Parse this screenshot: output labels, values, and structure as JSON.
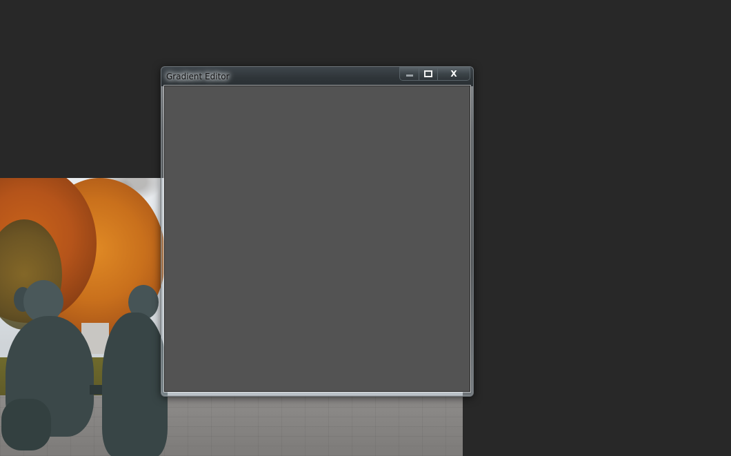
{
  "desktop": {
    "background_color": "#282828"
  },
  "window": {
    "title": "Gradient Editor",
    "client_color": "#535353",
    "buttons": {
      "minimize_icon": "minimize-icon",
      "maximize_icon": "maximize-icon",
      "close_icon": "close-icon",
      "close_glyph": "X"
    }
  }
}
